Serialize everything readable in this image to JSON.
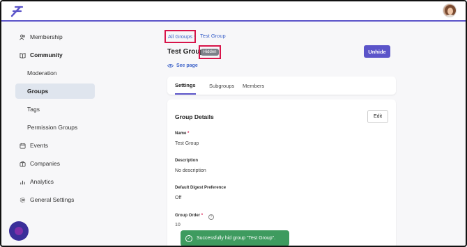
{
  "colors": {
    "accent": "#5b54c9",
    "highlight_box": "#d8144a",
    "link": "#3d63c9",
    "toast_bg": "#3e9b5f",
    "badge_bg": "#7d8088"
  },
  "sidebar": {
    "items": [
      {
        "label": "Membership",
        "icon": "users-icon"
      },
      {
        "label": "Community",
        "icon": "book-icon"
      },
      {
        "label": "Moderation"
      },
      {
        "label": "Groups"
      },
      {
        "label": "Tags"
      },
      {
        "label": "Permission Groups"
      },
      {
        "label": "Events",
        "icon": "calendar-icon"
      },
      {
        "label": "Companies",
        "icon": "briefcase-icon"
      },
      {
        "label": "Analytics",
        "icon": "bar-chart-icon"
      },
      {
        "label": "General Settings",
        "icon": "gear-icon"
      }
    ]
  },
  "breadcrumb": {
    "all": "All Groups",
    "separator": "‹",
    "current": "Test Group"
  },
  "header": {
    "title": "Test Group",
    "badge": "Hidden",
    "see_page": "See page",
    "unhide": "Unhide"
  },
  "tabs": [
    {
      "label": "Settings"
    },
    {
      "label": "Subgroups"
    },
    {
      "label": "Members"
    }
  ],
  "details": {
    "title": "Group Details",
    "edit": "Edit",
    "fields": [
      {
        "label": "Name",
        "required": "*",
        "value": "Test Group"
      },
      {
        "label": "Description",
        "value": "No description"
      },
      {
        "label": "Default Digest Preference",
        "value": "Off"
      },
      {
        "label": "Group Order",
        "required": "*",
        "value": "10"
      }
    ],
    "help": "?"
  },
  "toast": {
    "message": "Successfully hid group \"Test Group\"."
  }
}
